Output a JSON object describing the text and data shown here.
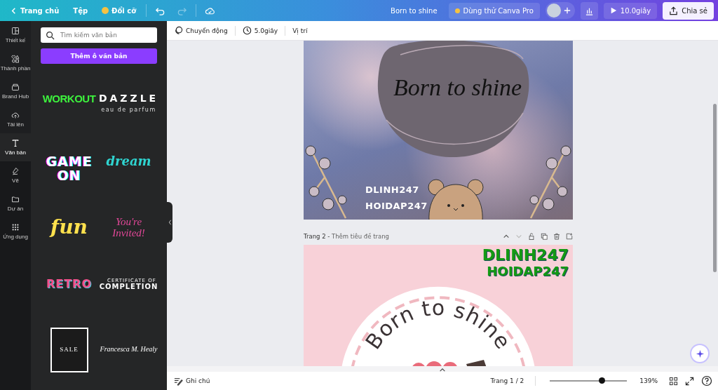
{
  "top_bar": {
    "back": "Trang chủ",
    "file": "Tệp",
    "resize": "Đổi cỡ",
    "design_title": "Born to shine",
    "pro_trial": "Dùng thử Canva Pro",
    "play_time": "10.0giây",
    "share": "Chia sẻ"
  },
  "rail": [
    {
      "label": "Thiết kế",
      "selected": false
    },
    {
      "label": "Thành phần",
      "selected": false
    },
    {
      "label": "Brand Hub",
      "selected": false
    },
    {
      "label": "Tải lên",
      "selected": false
    },
    {
      "label": "Văn bản",
      "selected": true
    },
    {
      "label": "Vẽ",
      "selected": false
    },
    {
      "label": "Dự án",
      "selected": false
    },
    {
      "label": "Ứng dụng",
      "selected": false
    }
  ],
  "panel": {
    "search": {
      "placeholder": "Tìm kiếm văn bản"
    },
    "add_button": "Thêm ô văn bản",
    "samples": [
      {
        "kind": "workout",
        "lines": [
          "WORKOUT"
        ]
      },
      {
        "kind": "dazzle",
        "lines": [
          "DAZZLE",
          "eau de parfum"
        ]
      },
      {
        "kind": "game",
        "lines": [
          "GAME",
          "ON"
        ]
      },
      {
        "kind": "dream",
        "lines": [
          "dream"
        ]
      },
      {
        "kind": "fun",
        "lines": [
          "fun"
        ]
      },
      {
        "kind": "invited",
        "lines": [
          "You're",
          "Invited!"
        ]
      },
      {
        "kind": "retro",
        "lines": [
          "RETRO"
        ]
      },
      {
        "kind": "certificate",
        "lines": [
          "CERTIFICATE OF",
          "COMPLETION"
        ]
      },
      {
        "kind": "sale",
        "lines": [
          "SALE"
        ]
      },
      {
        "kind": "signature",
        "lines": [
          "Francesca M. Healy"
        ]
      }
    ]
  },
  "toolbar": {
    "animate": "Chuyển động",
    "duration": "5.0giây",
    "position": "Vị trí"
  },
  "pages": [
    {
      "title": "Born to shine",
      "texts": [
        "DLINH247",
        "HOIDAP247"
      ]
    },
    {
      "label": "Trang 2 -",
      "title_placeholder": "Thêm tiêu đề trang",
      "texts": [
        "DLINH247",
        "HOIDAP247"
      ],
      "curved_text": "Born to shine"
    }
  ],
  "bottom_bar": {
    "notes": "Ghi chú",
    "page_indicator": "Trang 1 / 2",
    "zoom": {
      "level": 0.67
    },
    "zoom_reading": "139%"
  }
}
